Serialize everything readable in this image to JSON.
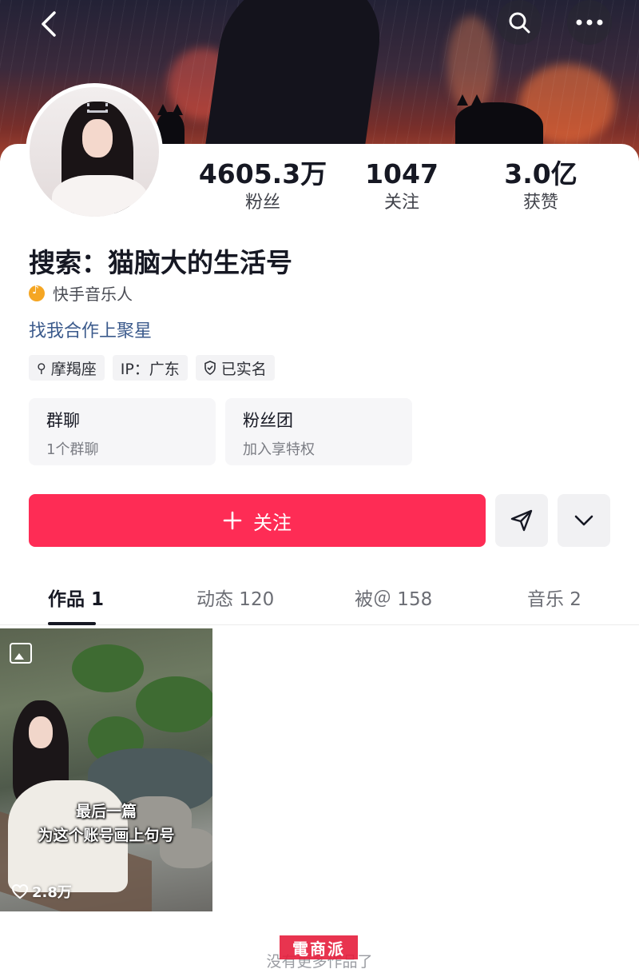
{
  "header": {
    "back_icon": "chevron-left-icon",
    "search_icon": "search-icon",
    "more_icon": "more-horizontal-icon"
  },
  "profile": {
    "stats": [
      {
        "value": "4605.3万",
        "label": "粉丝"
      },
      {
        "value": "1047",
        "label": "关注"
      },
      {
        "value": "3.0亿",
        "label": "获赞"
      }
    ],
    "name": "搜索：猫脑大的生活号",
    "badge": "快手音乐人",
    "bio": "找我合作上聚星",
    "tags": [
      {
        "icon": "zodiac-icon",
        "text": "摩羯座"
      },
      {
        "icon": "",
        "text": "IP：广东"
      },
      {
        "icon": "verified-shield-icon",
        "text": "已实名"
      }
    ],
    "tiles": [
      {
        "title": "群聊",
        "subtitle": "1个群聊"
      },
      {
        "title": "粉丝团",
        "subtitle": "加入享特权"
      }
    ]
  },
  "actions": {
    "follow_label": "关注",
    "follow_color": "#fe2c55",
    "share_icon": "send-icon",
    "expand_icon": "chevron-down-icon"
  },
  "tabs": [
    {
      "label": "作品 1",
      "active": true
    },
    {
      "label": "动态 120",
      "active": false
    },
    {
      "label": "被＠ 158",
      "active": false
    },
    {
      "label": "音乐 2",
      "active": false
    }
  ],
  "works": [
    {
      "caption_line1": "最后一篇",
      "caption_line2": "为这个账号画上句号",
      "likes": "2.8万",
      "type_icon": "gallery-icon"
    }
  ],
  "footer": {
    "end_text": "没有更多作品了",
    "watermark": "電商派"
  }
}
